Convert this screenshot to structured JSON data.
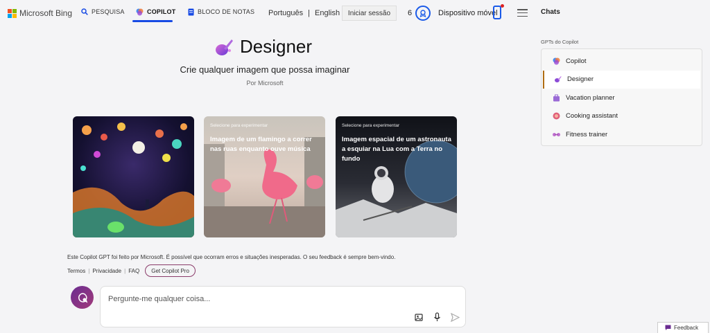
{
  "header": {
    "logo_text": "Microsoft Bing",
    "nav": [
      {
        "label": "PESQUISA",
        "icon": "search-icon"
      },
      {
        "label": "COPILOT",
        "icon": "copilot-icon",
        "active": true
      },
      {
        "label": "BLOCO DE NOTAS",
        "icon": "notebook-icon"
      }
    ],
    "lang_pt": "Português",
    "lang_sep": "|",
    "lang_en": "English",
    "signin": "Iniciar sessão",
    "rewards_count": "6",
    "mobile_label": "Dispositivo móvel",
    "chats_label": "Chats",
    "accent_color": "#174ae4"
  },
  "hero": {
    "title": "Designer",
    "subtitle": "Crie qualquer imagem que possa imaginar",
    "byline": "Por Microsoft"
  },
  "cards": [
    {
      "label_small": "",
      "caption": ""
    },
    {
      "label_small": "Selecione para experimentar",
      "caption": "Imagem de um flamingo a correr nas ruas enquanto ouve música"
    },
    {
      "label_small": "Selecione para experimentar",
      "caption": "Imagem espacial de um astronauta a esquiar na Lua com a Terra no fundo"
    }
  ],
  "footer": {
    "disclaimer": "Este Copilot GPT foi feito por Microsoft. É possível que ocorram erros e situações inesperadas. O seu feedback é sempre bem-vindo.",
    "link_terms": "Termos",
    "link_privacy": "Privacidade",
    "link_faq": "FAQ",
    "link_sep": "|",
    "pro_button": "Get Copilot Pro"
  },
  "input": {
    "placeholder": "Pergunte-me qualquer coisa..."
  },
  "sidebar": {
    "section_label": "GPTs do Copilot",
    "items": [
      {
        "label": "Copilot",
        "icon": "copilot-icon",
        "color": "#4a8cf0"
      },
      {
        "label": "Designer",
        "icon": "designer-icon",
        "color": "#8a4ad6",
        "active": true
      },
      {
        "label": "Vacation planner",
        "icon": "suitcase-icon",
        "color": "#9a6ad6"
      },
      {
        "label": "Cooking assistant",
        "icon": "cooking-icon",
        "color": "#e0607a"
      },
      {
        "label": "Fitness trainer",
        "icon": "dumbbell-icon",
        "color": "#c070d0"
      }
    ]
  },
  "feedback_label": "Feedback"
}
